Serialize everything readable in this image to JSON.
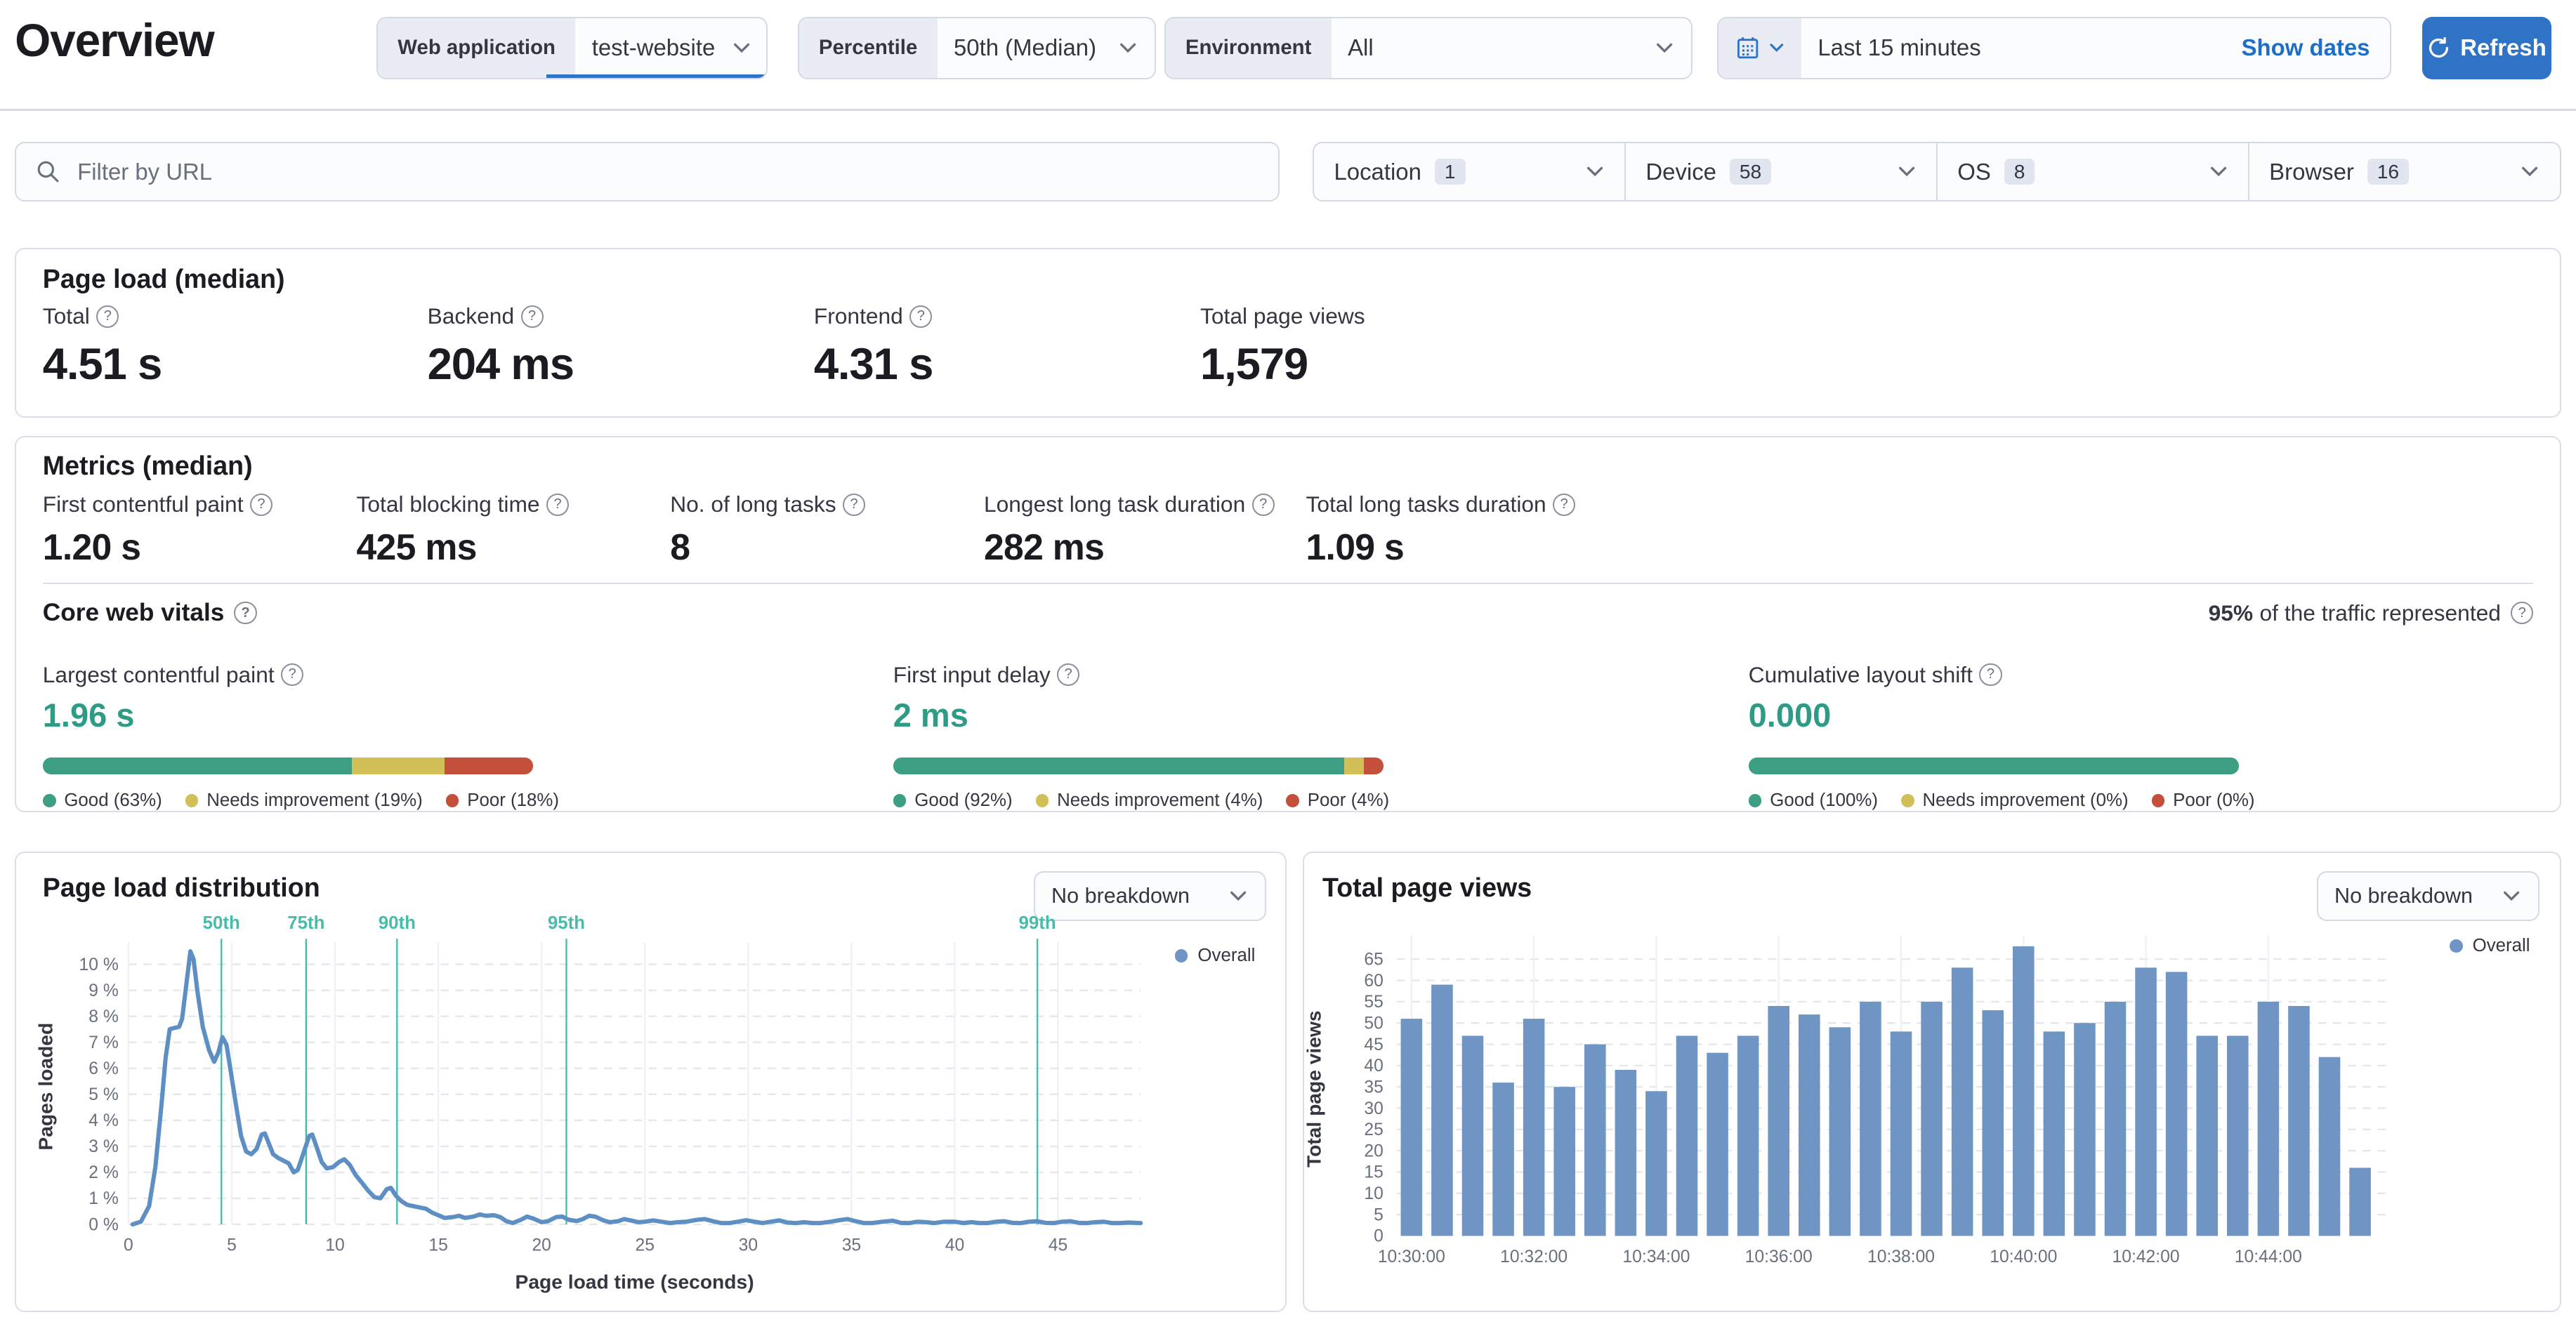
{
  "page": {
    "title": "Overview"
  },
  "header": {
    "web_application": {
      "label": "Web application",
      "value": "test-website"
    },
    "percentile": {
      "label": "Percentile",
      "value": "50th (Median)"
    },
    "environment": {
      "label": "Environment",
      "value": "All"
    },
    "time_picker": {
      "value": "Last 15 minutes",
      "show_dates_label": "Show dates"
    },
    "refresh_label": "Refresh"
  },
  "filters": {
    "url_filter_placeholder": "Filter by URL",
    "dropdowns": [
      {
        "label": "Location",
        "count": "1"
      },
      {
        "label": "Device",
        "count": "58"
      },
      {
        "label": "OS",
        "count": "8"
      },
      {
        "label": "Browser",
        "count": "16"
      }
    ]
  },
  "page_load_panel": {
    "title": "Page load (median)",
    "stats": [
      {
        "label": "Total",
        "value": "4.51 s"
      },
      {
        "label": "Backend",
        "value": "204 ms"
      },
      {
        "label": "Frontend",
        "value": "4.31 s"
      },
      {
        "label": "Total page views",
        "value": "1,579"
      }
    ]
  },
  "metrics_panel": {
    "title": "Metrics (median)",
    "stats": [
      {
        "label": "First contentful paint",
        "value": "1.20 s"
      },
      {
        "label": "Total blocking time",
        "value": "425 ms"
      },
      {
        "label": "No. of long tasks",
        "value": "8"
      },
      {
        "label": "Longest long task duration",
        "value": "282 ms"
      },
      {
        "label": "Total long tasks duration",
        "value": "1.09 s"
      }
    ],
    "core_web_vitals": {
      "title": "Core web vitals",
      "traffic_note_bold": "95%",
      "traffic_note_rest": "of the traffic represented",
      "status_colors": {
        "good": "#3c9e83",
        "needs_improvement": "#d3bf58",
        "poor": "#c4503c",
        "value_text": "#2e9c85"
      },
      "vitals": [
        {
          "label": "Largest contentful paint",
          "value": "1.96 s",
          "good_pct": 63,
          "ni_pct": 19,
          "poor_pct": 18,
          "legend": [
            "Good (63%)",
            "Needs improvement (19%)",
            "Poor (18%)"
          ]
        },
        {
          "label": "First input delay",
          "value": "2 ms",
          "good_pct": 92,
          "ni_pct": 4,
          "poor_pct": 4,
          "legend": [
            "Good (92%)",
            "Needs improvement (4%)",
            "Poor (4%)"
          ]
        },
        {
          "label": "Cumulative layout shift",
          "value": "0.000",
          "good_pct": 100,
          "ni_pct": 0,
          "poor_pct": 0,
          "legend": [
            "Good (100%)",
            "Needs improvement (0%)",
            "Poor (0%)"
          ]
        }
      ]
    }
  },
  "panels": {
    "distribution": {
      "title": "Page load distribution",
      "breakdown_value": "No breakdown",
      "legend": "Overall",
      "xlabel": "Page load time (seconds)",
      "ylabel": "Pages loaded"
    },
    "page_views": {
      "title": "Total page views",
      "breakdown_value": "No breakdown",
      "legend": "Overall",
      "ylabel": "Total page views"
    }
  },
  "chart_data": [
    {
      "type": "line",
      "title": "Page load distribution",
      "xlabel": "Page load time (seconds)",
      "ylabel": "Pages loaded",
      "xlim": [
        0,
        49
      ],
      "ylim": [
        0,
        10.6
      ],
      "x_ticks": [
        0,
        5,
        10,
        15,
        20,
        25,
        30,
        35,
        40,
        45
      ],
      "y_ticks": [
        0,
        1,
        2,
        3,
        4,
        5,
        6,
        7,
        8,
        9,
        10
      ],
      "y_tick_suffix": " %",
      "legend_position": "top-right",
      "grid": true,
      "line_color": "#5e8fc4",
      "marker_color": "#47bcaa",
      "percentile_markers": [
        {
          "label": "50th",
          "x": 4.5
        },
        {
          "label": "75th",
          "x": 8.6
        },
        {
          "label": "90th",
          "x": 13.0
        },
        {
          "label": "95th",
          "x": 21.2
        },
        {
          "label": "99th",
          "x": 44.0
        }
      ],
      "series": [
        {
          "name": "Overall",
          "points": [
            [
              0.2,
              0
            ],
            [
              0.6,
              0.1
            ],
            [
              1.0,
              0.7
            ],
            [
              1.3,
              2.2
            ],
            [
              1.6,
              4.6
            ],
            [
              1.8,
              6.4
            ],
            [
              2.0,
              7.5
            ],
            [
              2.2,
              7.55
            ],
            [
              2.45,
              7.6
            ],
            [
              2.6,
              7.9
            ],
            [
              2.8,
              9.2
            ],
            [
              3.0,
              10.5
            ],
            [
              3.15,
              10.2
            ],
            [
              3.35,
              8.9
            ],
            [
              3.6,
              7.6
            ],
            [
              3.9,
              6.7
            ],
            [
              4.15,
              6.25
            ],
            [
              4.35,
              6.6
            ],
            [
              4.55,
              7.2
            ],
            [
              4.75,
              6.9
            ],
            [
              4.95,
              5.9
            ],
            [
              5.2,
              4.6
            ],
            [
              5.45,
              3.4
            ],
            [
              5.7,
              2.8
            ],
            [
              5.95,
              2.7
            ],
            [
              6.2,
              2.9
            ],
            [
              6.45,
              3.45
            ],
            [
              6.6,
              3.5
            ],
            [
              6.8,
              3.1
            ],
            [
              7.0,
              2.7
            ],
            [
              7.25,
              2.55
            ],
            [
              7.5,
              2.45
            ],
            [
              7.75,
              2.35
            ],
            [
              8.0,
              2.0
            ],
            [
              8.2,
              2.1
            ],
            [
              8.5,
              2.8
            ],
            [
              8.75,
              3.4
            ],
            [
              8.9,
              3.45
            ],
            [
              9.1,
              3.0
            ],
            [
              9.35,
              2.4
            ],
            [
              9.6,
              2.15
            ],
            [
              9.9,
              2.2
            ],
            [
              10.2,
              2.4
            ],
            [
              10.45,
              2.5
            ],
            [
              10.7,
              2.3
            ],
            [
              11.0,
              1.9
            ],
            [
              11.3,
              1.6
            ],
            [
              11.6,
              1.3
            ],
            [
              11.9,
              1.05
            ],
            [
              12.2,
              1.0
            ],
            [
              12.5,
              1.35
            ],
            [
              12.7,
              1.4
            ],
            [
              12.95,
              1.1
            ],
            [
              13.2,
              0.9
            ],
            [
              13.5,
              0.75
            ],
            [
              13.8,
              0.7
            ],
            [
              14.1,
              0.65
            ],
            [
              14.4,
              0.6
            ],
            [
              14.7,
              0.45
            ],
            [
              15.0,
              0.35
            ],
            [
              15.3,
              0.25
            ],
            [
              15.7,
              0.28
            ],
            [
              16.0,
              0.33
            ],
            [
              16.3,
              0.25
            ],
            [
              16.7,
              0.3
            ],
            [
              17.0,
              0.38
            ],
            [
              17.3,
              0.33
            ],
            [
              17.7,
              0.35
            ],
            [
              18.0,
              0.28
            ],
            [
              18.3,
              0.12
            ],
            [
              18.6,
              0.05
            ],
            [
              19.0,
              0.18
            ],
            [
              19.3,
              0.3
            ],
            [
              19.6,
              0.22
            ],
            [
              20.0,
              0.08
            ],
            [
              20.3,
              0.12
            ],
            [
              20.7,
              0.28
            ],
            [
              21.0,
              0.3
            ],
            [
              21.3,
              0.18
            ],
            [
              21.7,
              0.13
            ],
            [
              22.0,
              0.2
            ],
            [
              22.3,
              0.33
            ],
            [
              22.6,
              0.3
            ],
            [
              23.0,
              0.15
            ],
            [
              23.3,
              0.08
            ],
            [
              23.7,
              0.12
            ],
            [
              24.0,
              0.2
            ],
            [
              24.3,
              0.15
            ],
            [
              24.7,
              0.08
            ],
            [
              25.0,
              0.1
            ],
            [
              25.4,
              0.15
            ],
            [
              25.8,
              0.1
            ],
            [
              26.2,
              0.05
            ],
            [
              26.6,
              0.08
            ],
            [
              27.0,
              0.1
            ],
            [
              27.5,
              0.17
            ],
            [
              27.9,
              0.2
            ],
            [
              28.3,
              0.12
            ],
            [
              28.7,
              0.05
            ],
            [
              29.1,
              0.05
            ],
            [
              29.5,
              0.1
            ],
            [
              29.9,
              0.16
            ],
            [
              30.3,
              0.1
            ],
            [
              30.7,
              0.05
            ],
            [
              31.1,
              0.1
            ],
            [
              31.5,
              0.15
            ],
            [
              31.9,
              0.07
            ],
            [
              32.3,
              0.05
            ],
            [
              32.7,
              0.08
            ],
            [
              33.1,
              0.05
            ],
            [
              33.5,
              0.05
            ],
            [
              34.0,
              0.1
            ],
            [
              34.4,
              0.16
            ],
            [
              34.8,
              0.2
            ],
            [
              35.2,
              0.12
            ],
            [
              35.6,
              0.05
            ],
            [
              36.0,
              0.05
            ],
            [
              36.5,
              0.1
            ],
            [
              37.0,
              0.14
            ],
            [
              37.4,
              0.06
            ],
            [
              37.8,
              0.05
            ],
            [
              38.2,
              0.1
            ],
            [
              38.6,
              0.08
            ],
            [
              39.0,
              0.05
            ],
            [
              39.5,
              0.1
            ],
            [
              40.0,
              0.1
            ],
            [
              40.4,
              0.05
            ],
            [
              40.8,
              0.08
            ],
            [
              41.2,
              0.05
            ],
            [
              41.6,
              0.05
            ],
            [
              42.0,
              0.1
            ],
            [
              42.4,
              0.12
            ],
            [
              42.8,
              0.06
            ],
            [
              43.2,
              0.05
            ],
            [
              43.6,
              0.1
            ],
            [
              44.0,
              0.12
            ],
            [
              44.4,
              0.06
            ],
            [
              44.8,
              0.05
            ],
            [
              45.2,
              0.1
            ],
            [
              45.6,
              0.12
            ],
            [
              46.0,
              0.06
            ],
            [
              46.4,
              0.05
            ],
            [
              46.8,
              0.08
            ],
            [
              47.2,
              0.1
            ],
            [
              47.6,
              0.05
            ],
            [
              48.0,
              0.05
            ],
            [
              48.4,
              0.07
            ],
            [
              48.8,
              0.06
            ],
            [
              49.0,
              0.05
            ]
          ]
        }
      ]
    },
    {
      "type": "bar",
      "title": "Total page views",
      "ylabel": "Total page views",
      "ylim": [
        0,
        69
      ],
      "y_ticks": [
        0,
        5,
        10,
        15,
        20,
        25,
        30,
        35,
        40,
        45,
        50,
        55,
        60,
        65
      ],
      "bar_color": "#6e95c3",
      "grid": true,
      "legend_position": "top-right",
      "categories": [
        "10:30:00",
        "10:30:30",
        "10:31:00",
        "10:31:30",
        "10:32:00",
        "10:32:30",
        "10:33:00",
        "10:33:30",
        "10:34:00",
        "10:34:30",
        "10:35:00",
        "10:35:30",
        "10:36:00",
        "10:36:30",
        "10:37:00",
        "10:37:30",
        "10:38:00",
        "10:38:30",
        "10:39:00",
        "10:39:30",
        "10:40:00",
        "10:40:30",
        "10:41:00",
        "10:41:30",
        "10:42:00",
        "10:42:30",
        "10:43:00",
        "10:43:30",
        "10:44:00",
        "10:44:30",
        "10:45:00",
        "10:45:30"
      ],
      "x_tick_labels": [
        "10:30:00",
        "10:32:00",
        "10:34:00",
        "10:36:00",
        "10:38:00",
        "10:40:00",
        "10:42:00",
        "10:44:00"
      ],
      "series": [
        {
          "name": "Overall",
          "values": [
            51,
            59,
            47,
            36,
            51,
            35,
            45,
            39,
            34,
            47,
            43,
            47,
            54,
            52,
            49,
            55,
            48,
            55,
            63,
            53,
            68,
            48,
            50,
            55,
            63,
            62,
            47,
            47,
            55,
            54,
            42,
            16
          ]
        }
      ]
    }
  ]
}
